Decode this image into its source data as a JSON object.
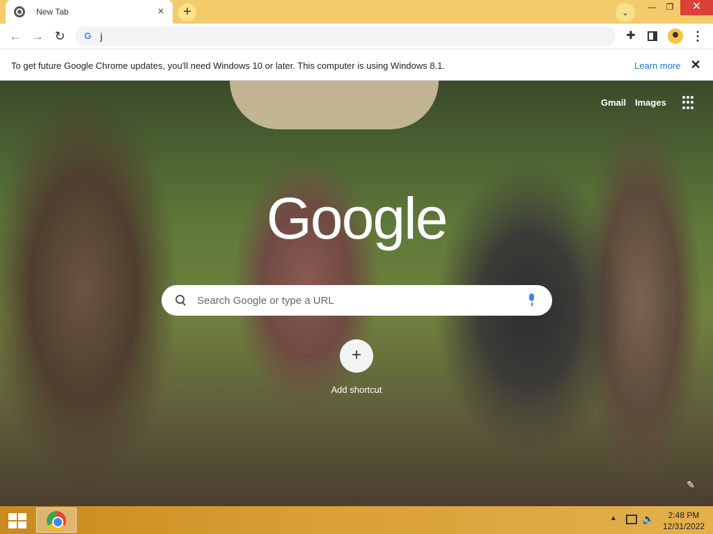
{
  "tab": {
    "title": "New Tab",
    "close": "×"
  },
  "toolbar": {
    "omnibox_text": "j",
    "google_g": "G"
  },
  "infobar": {
    "message": "To get future Google Chrome updates, you'll need Windows 10 or later. This computer is using Windows 8.1.",
    "learn_more": "Learn more"
  },
  "ntp": {
    "gmail": "Gmail",
    "images": "Images",
    "logo": "Google",
    "search_placeholder": "Search Google or type a URL",
    "add_shortcut": "Add shortcut"
  },
  "taskbar": {
    "time": "2:48 PM",
    "date": "12/31/2022"
  },
  "colors": {
    "tabstrip": "#f4cb6a",
    "accent_link": "#1a73e8",
    "taskbar": "#d9a035"
  }
}
